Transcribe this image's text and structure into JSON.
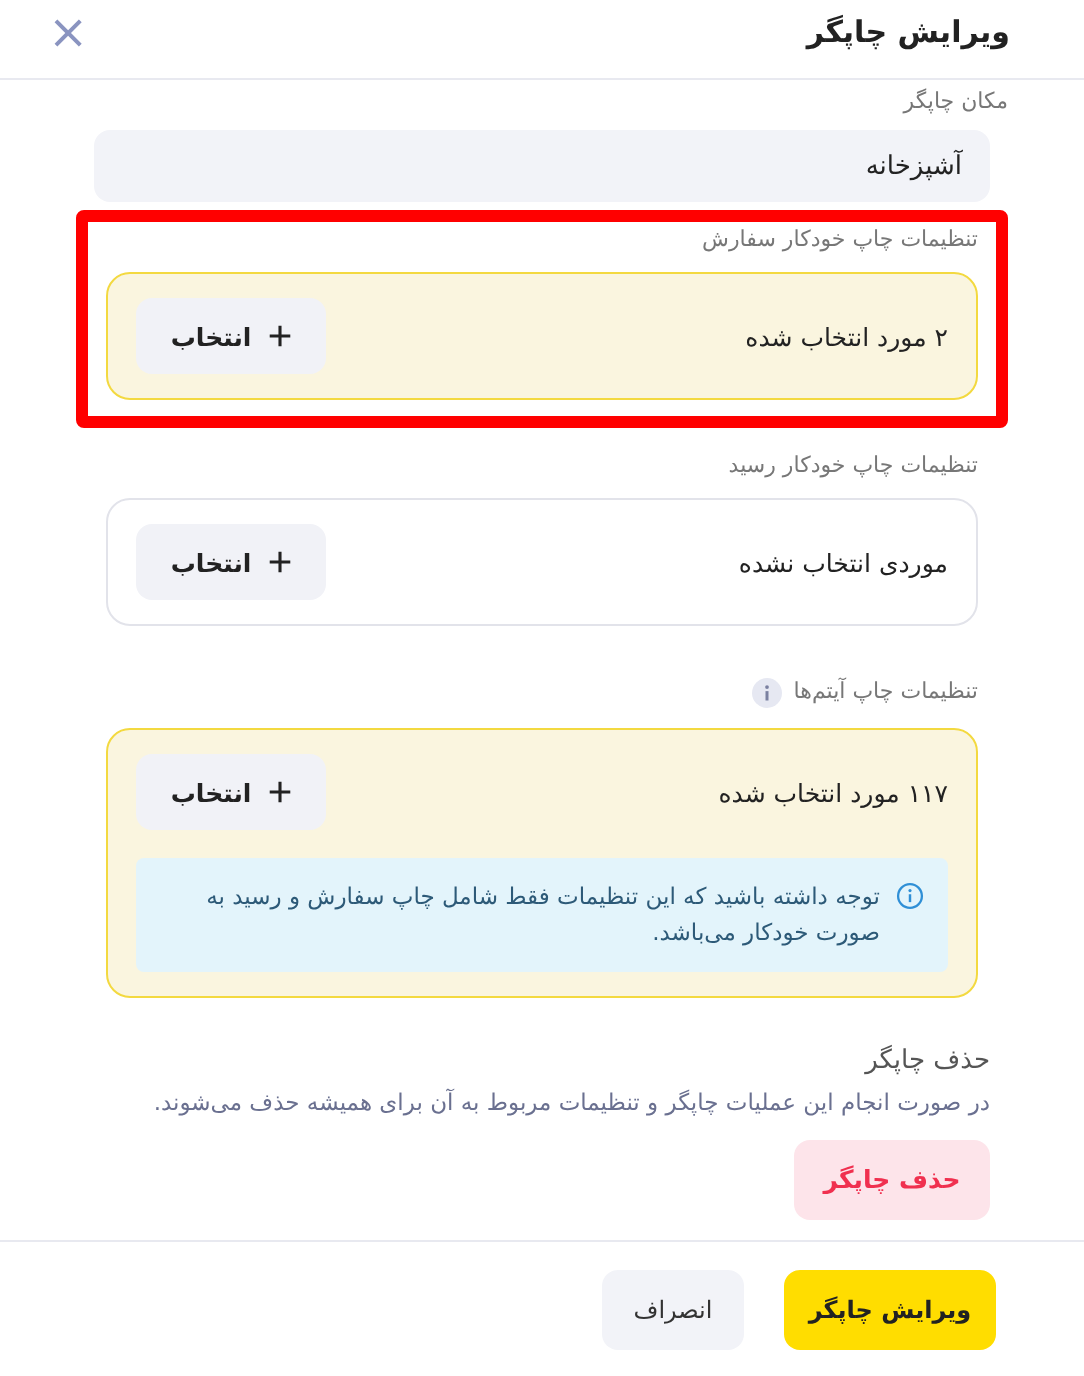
{
  "header": {
    "title": "ویرایش چاپگر",
    "close": "×"
  },
  "location": {
    "label": "مکان چاپگر",
    "value": "آشپزخانه"
  },
  "sections": [
    {
      "label": "تنظیمات چاپ خودکار سفارش",
      "summary": "۲ مورد انتخاب شده",
      "button": "انتخاب",
      "has_selection": true,
      "highlighted": true,
      "info": false
    },
    {
      "label": "تنظیمات چاپ خودکار رسید",
      "summary": "موردی انتخاب نشده",
      "button": "انتخاب",
      "has_selection": false,
      "highlighted": false,
      "info": false
    },
    {
      "label": "تنظیمات چاپ آیتم‌ها",
      "summary": "۱۱۷ مورد انتخاب شده",
      "button": "انتخاب",
      "has_selection": true,
      "highlighted": false,
      "info": true,
      "note": "توجه داشته باشید که این تنظیمات فقط شامل چاپ سفارش و رسید به صورت خودکار می‌باشد."
    }
  ],
  "delete": {
    "title": "حذف چاپگر",
    "description": "در صورت انجام این عملیات چاپگر و تنظیمات مربوط به آن برای همیشه حذف می‌شوند.",
    "button": "حذف چاپگر"
  },
  "footer": {
    "buttons": [
      {
        "label": "ویرایش چاپگر",
        "kind": "primary"
      },
      {
        "label": "انصراف",
        "kind": "secondary"
      }
    ]
  }
}
